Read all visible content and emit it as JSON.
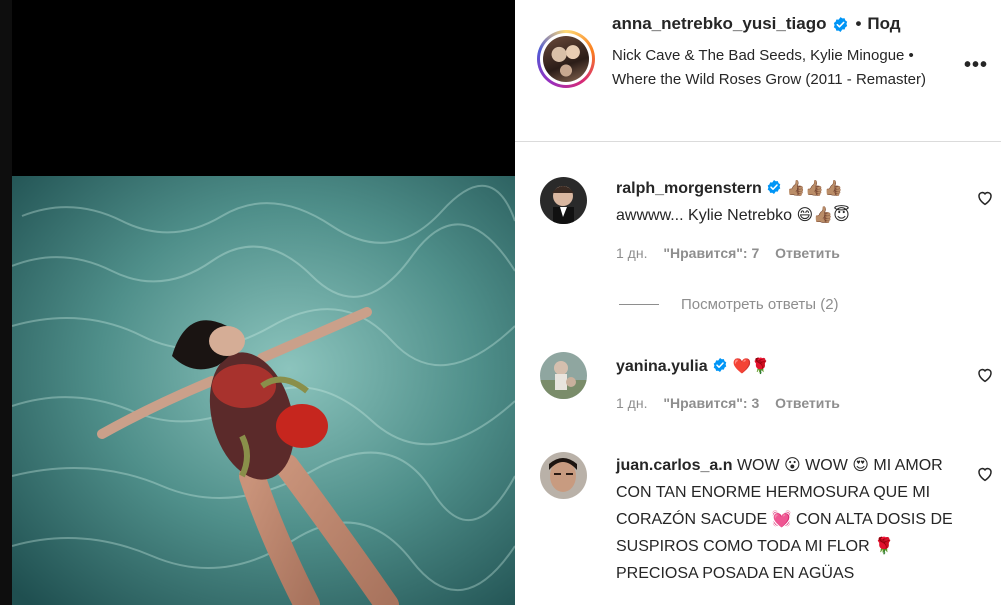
{
  "post": {
    "username": "anna_netrebko_yusi_tiago",
    "separator": "•",
    "follow_truncated": "Под",
    "song": "Nick Cave & The Bad Seeds, Kylie Minogue • Where the Wild Roses Grow (2011 - Remaster)",
    "more_icon": "more-horizontal-icon",
    "verified_color": "#0095f6"
  },
  "comments": [
    {
      "username": "ralph_morgenstern",
      "text_prefix": "👍🏽👍🏽👍🏽",
      "text": "awwww... Kylie Netrebko 😄👍🏽😇",
      "time": "1 дн.",
      "likes": "\"Нравится\": 7",
      "reply": "Ответить",
      "view_replies": "Посмотреть ответы (2)"
    },
    {
      "username": "yanina.yulia",
      "text_prefix": "❤️🌹",
      "text": "",
      "time": "1 дн.",
      "likes": "\"Нравится\": 3",
      "reply": "Ответить"
    },
    {
      "username": "juan.carlos_a.n",
      "text": "WOW 😮 WOW 😍 MI AMOR CON TAN ENORME HERMOSURA QUE MI CORAZÓN SACUDE 💓 CON ALTA DOSIS DE SUSPIROS COMO TODA MI FLOR 🌹 PRECIOSA POSADA EN AGÜAS"
    }
  ]
}
